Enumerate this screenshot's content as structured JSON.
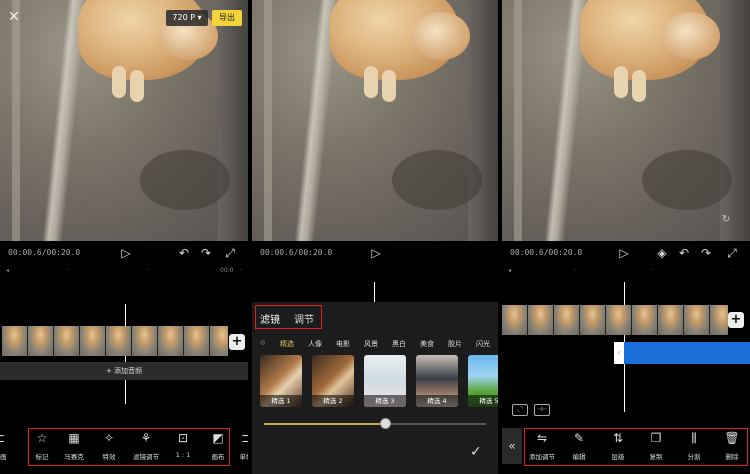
{
  "panel1": {
    "resolution": "720 P",
    "export_label": "导出",
    "time": "00:00.6/00:20.0",
    "ruler": [
      "00:0",
      "00:0"
    ],
    "add_audio": "+ 添加音频",
    "left_edge_label": "中画",
    "right_edge_label": "单帧",
    "tools": [
      {
        "icon": "☆",
        "label": "标记"
      },
      {
        "icon": "▦",
        "label": "马赛克"
      },
      {
        "icon": "✧",
        "label": "特效"
      },
      {
        "icon": "⚘",
        "label": "滤镜调节"
      },
      {
        "icon": "⊡",
        "label": "1 : 1"
      },
      {
        "icon": "◩",
        "label": "画布"
      }
    ]
  },
  "panel2": {
    "time": "00:00.6/00:20.0",
    "tabs": [
      "滤镜",
      "调节"
    ],
    "categories": [
      "精选",
      "人像",
      "电影",
      "风景",
      "黑白",
      "美食",
      "胶片",
      "闪光"
    ],
    "filters": [
      "精选 1",
      "精选 2",
      "精选 3",
      "精选 4",
      "精选 5"
    ],
    "slider_value": 0.55,
    "confirm_icon": "✓"
  },
  "panel3": {
    "time": "00:00.6/00:20.0",
    "tools": [
      {
        "icon": "⇋",
        "label": "添加调节"
      },
      {
        "icon": "✎",
        "label": "编辑"
      },
      {
        "icon": "⇅",
        "label": "层级"
      },
      {
        "icon": "❐",
        "label": "复制"
      },
      {
        "icon": "⫼",
        "label": "分割"
      },
      {
        "icon": "🗑",
        "label": "删除"
      }
    ]
  },
  "colors": {
    "accent_yellow": "#f5d33a",
    "red_highlight": "#e02020",
    "clip_blue": "#1a6fd8",
    "gold_selected": "#e8c25a"
  }
}
